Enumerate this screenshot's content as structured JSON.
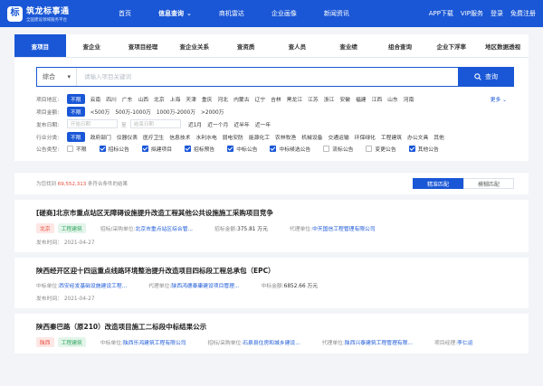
{
  "header": {
    "logo_title": "筑龙标事通",
    "logo_sub": "全国建设领域服务平台",
    "nav": [
      "首页",
      "信息查询",
      "商机雷达",
      "企业画像",
      "新闻资讯"
    ],
    "active_nav": "信息查询",
    "right": [
      "APP下载",
      "VIP服务",
      "登录",
      "免费注册"
    ],
    "brand_color": "#1a57d6"
  },
  "tabs": [
    "查项目",
    "查企业",
    "查项目经理",
    "查企业关系",
    "查资质",
    "查人员",
    "查业绩",
    "组合查询",
    "企业下浮率",
    "地区数据透视"
  ],
  "search": {
    "category": "综合",
    "placeholder": "请输入项目关键词",
    "button": "查询"
  },
  "filters": {
    "region": {
      "label": "项目地区:",
      "selected": "不限",
      "options": [
        "云南",
        "四川",
        "广东",
        "山西",
        "北京",
        "上海",
        "天津",
        "重庆",
        "河北",
        "内蒙古",
        "辽宁",
        "吉林",
        "黑龙江",
        "江苏",
        "浙江",
        "安徽",
        "福建",
        "江西",
        "山东",
        "河南"
      ],
      "more": "更多"
    },
    "amount": {
      "label": "项目金额:",
      "selected": "不限",
      "options": [
        "<500万",
        "500万-1000万",
        "1000万-2000万",
        ">2000万"
      ]
    },
    "date": {
      "label": "发布日期:",
      "start": "开始日期",
      "sep": "至",
      "end": "结束日期",
      "options": [
        "近1月",
        "近一个月",
        "近半年",
        "近一年"
      ]
    },
    "industry": {
      "label": "行业分类:",
      "selected": "不限",
      "options": [
        "政府部门",
        "仪器仪表",
        "医疗卫生",
        "信息技术",
        "水利水电",
        "弱电安防",
        "能源化工",
        "农林牧渔",
        "机械设备",
        "交通运输",
        "环保绿化",
        "工程建筑",
        "办公文具",
        "其他"
      ]
    },
    "announce": {
      "label": "公告类型:",
      "options": [
        {
          "text": "不限",
          "checked": false
        },
        {
          "text": "招标公告",
          "checked": true
        },
        {
          "text": "拟建项目",
          "checked": true
        },
        {
          "text": "招标预告",
          "checked": true
        },
        {
          "text": "中标公告",
          "checked": true
        },
        {
          "text": "中标候选公告",
          "checked": true
        },
        {
          "text": "流标公告",
          "checked": false
        },
        {
          "text": "变更公告",
          "checked": false
        },
        {
          "text": "其他公告",
          "checked": true
        }
      ]
    }
  },
  "summary": {
    "prefix": "为您找到",
    "count": "69,552,313",
    "suffix": "条符合条件的结果",
    "modes": [
      "精准匹配",
      "模糊匹配"
    ],
    "active_mode": "精准匹配"
  },
  "items": [
    {
      "title": "[磋商]北京市重点站区无障碍设施提升改造工程其他公共设施施工采购项目竞争",
      "tags": [
        {
          "text": "北京",
          "color": "red"
        },
        {
          "text": "工程建筑",
          "color": "green"
        }
      ],
      "fields": [
        {
          "k": "招标/采购单位:",
          "v": "北京市重点站区综合管...",
          "style": "link"
        },
        {
          "k": "招标金额:",
          "v": "375.81 万元",
          "style": "plain"
        },
        {
          "k": "代理单位:",
          "v": "中天国信工程管理有限公司",
          "style": "link"
        }
      ],
      "pub": "发布时间： 2021-04-27"
    },
    {
      "title": "陕西经开区迎十四运重点线路环境整治提升改造项目四标段工程总承包（EPC）",
      "tags": [],
      "fields": [
        {
          "k": "中标单位:",
          "v": "西安经发基础设施建设工程...",
          "style": "link"
        },
        {
          "k": "代理单位:",
          "v": "陕西鸿德泰康建设项目管理...",
          "style": "link"
        },
        {
          "k": "中标金额:",
          "v": "6852.66 万元",
          "style": "plain"
        }
      ],
      "pub": "发布时间： 2021-04-27"
    },
    {
      "title": "陕西秦巴路（原210）改造项目施工二标段中标结果公示",
      "tags": [
        {
          "text": "陕西",
          "color": "red"
        },
        {
          "text": "工程建筑",
          "color": "green"
        }
      ],
      "fields": [
        {
          "k": "中标单位:",
          "v": "陕西乐鸿建筑工程有限公司",
          "style": "link"
        },
        {
          "k": "招标/采购单位:",
          "v": "石泉县住房和城乡建设...",
          "style": "link"
        },
        {
          "k": "代理单位:",
          "v": "陕西兴泰建筑工程管理有限...",
          "style": "link"
        },
        {
          "k": "项目经理:",
          "v": "李仁运",
          "style": "link"
        }
      ],
      "pub": ""
    }
  ]
}
